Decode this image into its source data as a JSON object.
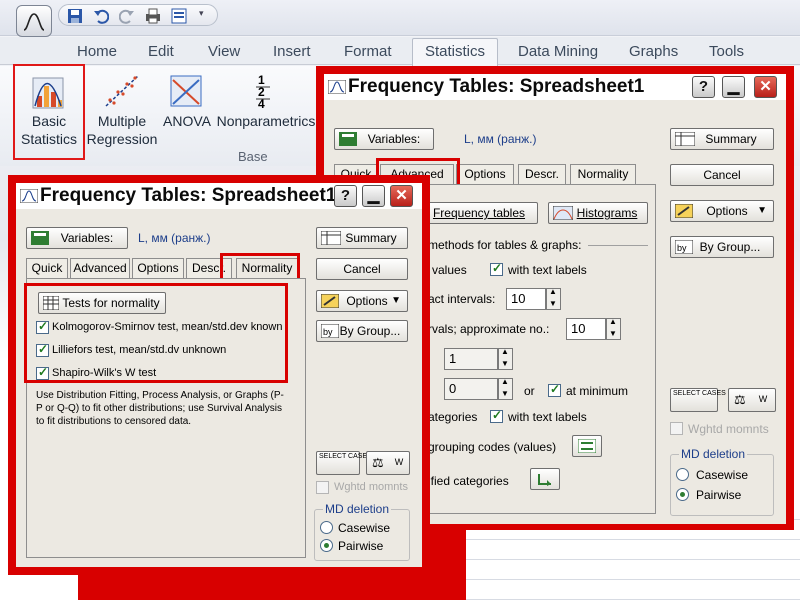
{
  "ribbon": {
    "tabs": [
      "Home",
      "Edit",
      "View",
      "Insert",
      "Format",
      "Statistics",
      "Data Mining",
      "Graphs",
      "Tools"
    ],
    "active_tab": "Statistics",
    "buttons": [
      {
        "line1": "Basic",
        "line2": "Statistics"
      },
      {
        "line1": "Multiple",
        "line2": "Regression"
      },
      {
        "line1": "ANOVA",
        "line2": ""
      },
      {
        "line1": "Nonparametrics",
        "line2": ""
      }
    ],
    "group_label": "Base"
  },
  "back_dialog": {
    "title": "Frequency Tables: Spreadsheet1",
    "variables_label": "Variables:",
    "variables_value": "L, мм (ранж.)",
    "summary_label": "Summary",
    "cancel_label": "Cancel",
    "options_label": "Options",
    "by_group_label": "By Group...",
    "tabs": [
      "Quick",
      "Advanced",
      "Options",
      "Descr.",
      "Normality"
    ],
    "active_tab": "Advanced",
    "frequency_tables_btn": "Frequency tables",
    "histograms_btn": "Histograms",
    "methods_heading": "methods for tables & graphs:",
    "rows": {
      "values": "values",
      "with_text_labels_1": "with text labels",
      "exact_intervals": "act intervals:",
      "exact_intervals_value": "10",
      "approx_intervals": "rvals; approximate no.:",
      "approx_intervals_value": "10",
      "spin3_value": "1",
      "spin4_value": "0",
      "or_label": "or",
      "at_minimum": "at minimum",
      "categories": "ategories",
      "with_text_labels_2": "with text labels",
      "grouping_codes": "grouping codes (values)",
      "specified_categories": "ified categories"
    },
    "select_cases": "SELECT CASES",
    "w_label": "W",
    "wghtd_momnts": "Wghtd momnts",
    "md_deletion": "MD deletion",
    "casewise": "Casewise",
    "pairwise": "Pairwise",
    "selected_md": "pairwise"
  },
  "front_dialog": {
    "title": "Frequency Tables: Spreadsheet1",
    "variables_label": "Variables:",
    "variables_value": "L, мм (ранж.)",
    "summary_label": "Summary",
    "cancel_label": "Cancel",
    "options_label": "Options",
    "by_group_label": "By Group...",
    "tabs": [
      "Quick",
      "Advanced",
      "Options",
      "Descr.",
      "Normality"
    ],
    "active_tab": "Normality",
    "tests_button": "Tests for normality",
    "checks": [
      {
        "label": "Kolmogorov-Smirnov test, mean/std.dev known",
        "checked": true
      },
      {
        "label": "Lilliefors test, mean/std.dv unknown",
        "checked": true
      },
      {
        "label": "Shapiro-Wilk's W test",
        "checked": true
      }
    ],
    "note": "Use Distribution Fitting, Process Analysis, or Graphs (P-P or Q-Q) to fit other distributions; use Survival Analysis to fit distributions to censored data.",
    "select_cases": "SELECT CASES",
    "w_label": "W",
    "wghtd_momnts": "Wghtd momnts",
    "md_deletion": "MD deletion",
    "casewise": "Casewise",
    "pairwise": "Pairwise",
    "selected_md": "pairwise"
  },
  "colors": {
    "highlight": "#d80000",
    "dialog_bg": "#ece9e2",
    "title_text": "#0b0b0b"
  }
}
